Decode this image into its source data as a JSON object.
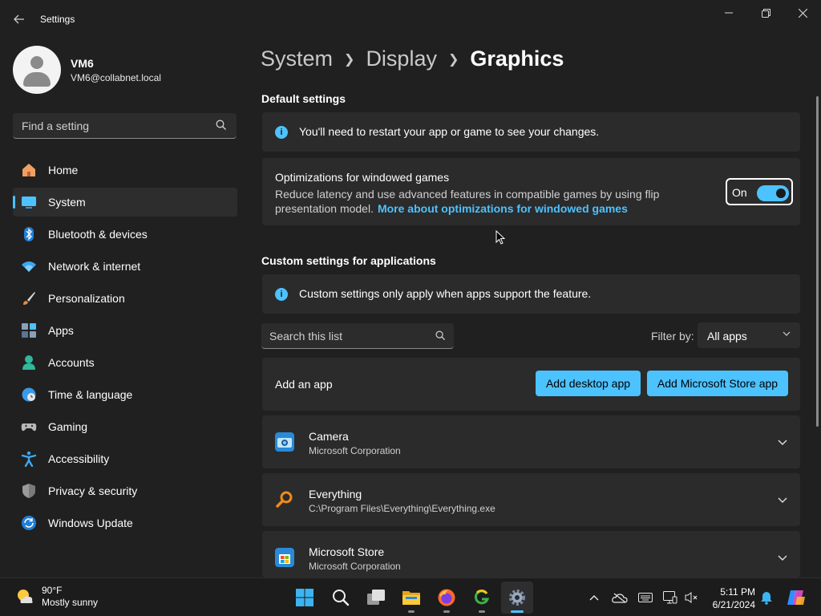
{
  "window": {
    "title": "Settings"
  },
  "profile": {
    "name": "VM6",
    "email": "VM6@collabnet.local"
  },
  "search": {
    "placeholder": "Find a setting"
  },
  "nav": [
    {
      "label": "Home",
      "icon": "home-icon"
    },
    {
      "label": "System",
      "icon": "system-icon",
      "active": true
    },
    {
      "label": "Bluetooth & devices",
      "icon": "bluetooth-icon"
    },
    {
      "label": "Network & internet",
      "icon": "wifi-icon"
    },
    {
      "label": "Personalization",
      "icon": "brush-icon"
    },
    {
      "label": "Apps",
      "icon": "apps-icon"
    },
    {
      "label": "Accounts",
      "icon": "accounts-icon"
    },
    {
      "label": "Time & language",
      "icon": "globe-clock-icon"
    },
    {
      "label": "Gaming",
      "icon": "gamepad-icon"
    },
    {
      "label": "Accessibility",
      "icon": "accessibility-icon"
    },
    {
      "label": "Privacy & security",
      "icon": "shield-icon"
    },
    {
      "label": "Windows Update",
      "icon": "update-icon"
    }
  ],
  "breadcrumb": [
    "System",
    "Display",
    "Graphics"
  ],
  "default_settings": {
    "title": "Default settings",
    "restart_notice": "You'll need to restart your app or game to see your changes.",
    "optimization": {
      "title": "Optimizations for windowed games",
      "description": "Reduce latency and use advanced features in compatible games by using flip presentation model.",
      "link": "More about optimizations for windowed games",
      "toggle_label": "On",
      "toggle_on": true
    }
  },
  "custom_settings": {
    "title": "Custom settings for applications",
    "notice": "Custom settings only apply when apps support the feature.",
    "list_search_placeholder": "Search this list",
    "filter_label": "Filter by:",
    "filter_value": "All apps",
    "add_app_label": "Add an app",
    "add_desktop_button": "Add desktop app",
    "add_store_button": "Add Microsoft Store app",
    "apps": [
      {
        "name": "Camera",
        "sub": "Microsoft Corporation",
        "icon": "camera-icon"
      },
      {
        "name": "Everything",
        "sub": "C:\\Program Files\\Everything\\Everything.exe",
        "icon": "everything-icon"
      },
      {
        "name": "Microsoft Store",
        "sub": "Microsoft Corporation",
        "icon": "store-icon"
      }
    ]
  },
  "taskbar": {
    "weather_temp": "90°F",
    "weather_desc": "Mostly sunny",
    "time": "5:11 PM",
    "date": "6/21/2024"
  },
  "colors": {
    "accent": "#4cc2ff",
    "background": "#202020",
    "card": "#2b2b2b"
  }
}
